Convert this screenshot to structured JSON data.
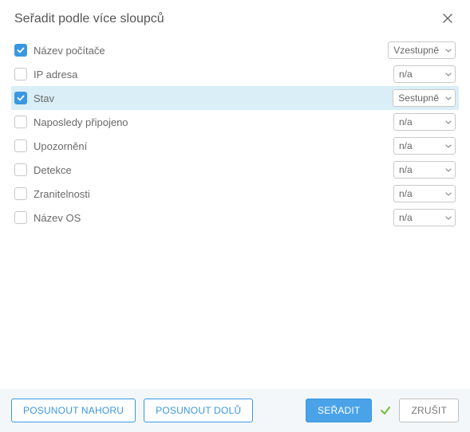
{
  "title": "Seřadit podle více sloupců",
  "columns": [
    {
      "label": "Název počítače",
      "checked": true,
      "order": "Vzestupně",
      "selected": false
    },
    {
      "label": "IP adresa",
      "checked": false,
      "order": "n/a",
      "selected": false
    },
    {
      "label": "Stav",
      "checked": true,
      "order": "Sestupně",
      "selected": true
    },
    {
      "label": "Naposledy připojeno",
      "checked": false,
      "order": "n/a",
      "selected": false
    },
    {
      "label": "Upozornění",
      "checked": false,
      "order": "n/a",
      "selected": false
    },
    {
      "label": "Detekce",
      "checked": false,
      "order": "n/a",
      "selected": false
    },
    {
      "label": "Zranitelnosti",
      "checked": false,
      "order": "n/a",
      "selected": false
    },
    {
      "label": "Název OS",
      "checked": false,
      "order": "n/a",
      "selected": false
    }
  ],
  "buttons": {
    "move_up": "POSUNOUT NAHORU",
    "move_down": "POSUNOUT DOLŮ",
    "sort": "SEŘADIT",
    "cancel": "ZRUŠIT"
  }
}
